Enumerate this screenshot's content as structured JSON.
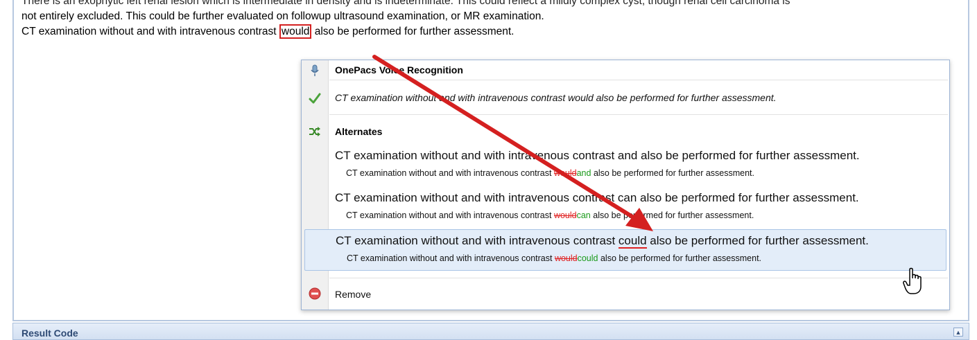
{
  "report": {
    "line0": "There is an exophytic left renal lesion which is intermediate in density and is indeterminate. This could reflect a mildly complex cyst, though renal cell carcinoma is",
    "line1": "not entirely excluded. This could be further evaluated on followup ultrasound examination, or MR examination.",
    "line2_before": "CT examination without and with intravenous contrast ",
    "line2_word": "would",
    "line2_after": " also be performed for further assessment."
  },
  "section": {
    "title": "Result Code",
    "collapse_glyph": "▲"
  },
  "popup": {
    "title": "OnePacs Voice Recognition",
    "current": "CT examination without and with intravenous contrast would also be performed for further assessment.",
    "alternates_label": "Alternates",
    "alternates": [
      {
        "main_before": "CT examination without and with intravenous contrast ",
        "main_word": "and",
        "main_after": " also be performed for further assessment.",
        "sub_before": "CT examination without and with intravenous contrast ",
        "sub_del": "would",
        "sub_ins": "and",
        "sub_after": " also be performed for further assessment."
      },
      {
        "main_before": "CT examination without and with intravenous contrast ",
        "main_word": "can",
        "main_after": " also be performed for further assessment.",
        "sub_before": "CT examination without and with intravenous contrast ",
        "sub_del": "would",
        "sub_ins": "can",
        "sub_after": " also be performed for further assessment."
      },
      {
        "main_before": "CT examination without and with intravenous contrast ",
        "main_word": "could",
        "main_after": " also be performed for further assessment.",
        "sub_before": "CT examination without and with intravenous contrast ",
        "sub_del": "would",
        "sub_ins": "could",
        "sub_after": " also be performed for further assessment."
      }
    ],
    "remove_label": "Remove"
  },
  "icons": {
    "title": "microphone-icon",
    "current": "checkmark-icon",
    "alternates": "shuffle-icon",
    "remove": "remove-icon",
    "cursor": "hand-pointer-icon"
  },
  "colors": {
    "highlight_red": "#d42020",
    "inserted_green": "#1a9a1a",
    "selected_bg": "#e3edf9",
    "frame_blue": "#b7c8e0"
  }
}
